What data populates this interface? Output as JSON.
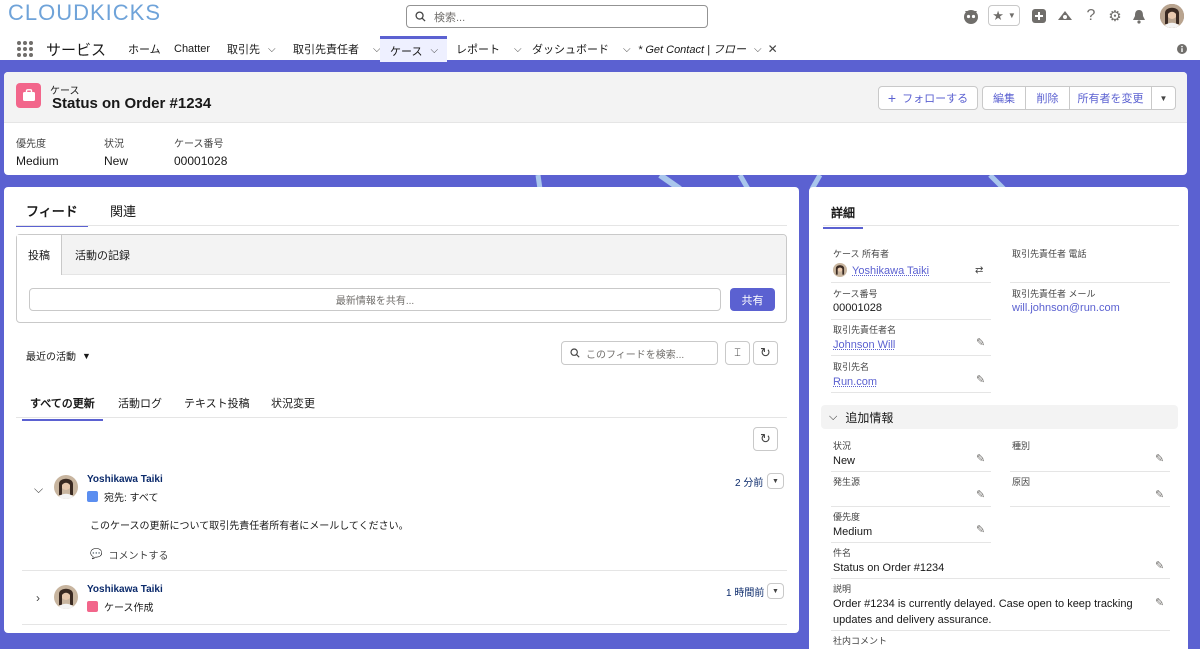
{
  "brand": {
    "logo": "CLOUDKICKS"
  },
  "search": {
    "placeholder": "検索..."
  },
  "nav": {
    "app_name": "サービス",
    "items": [
      {
        "label": "ホーム"
      },
      {
        "label": "Chatter"
      },
      {
        "label": "取引先"
      },
      {
        "label": "取引先責任者"
      },
      {
        "label": "ケース"
      },
      {
        "label": "レポート"
      },
      {
        "label": "ダッシュボード"
      },
      {
        "label": "* Get Contact | フロー"
      }
    ]
  },
  "record": {
    "object": "ケース",
    "title": "Status on Order #1234",
    "actions": {
      "follow": "フォローする",
      "edit": "編集",
      "delete": "削除",
      "change_owner": "所有者を変更"
    },
    "highlights": [
      {
        "label": "優先度",
        "value": "Medium"
      },
      {
        "label": "状況",
        "value": "New"
      },
      {
        "label": "ケース番号",
        "value": "00001028"
      }
    ]
  },
  "feed": {
    "tabs": {
      "feed": "フィード",
      "related": "関連"
    },
    "publisher": {
      "tab_post": "投稿",
      "tab_log": "活動の記録",
      "placeholder": "最新情報を共有...",
      "share": "共有"
    },
    "sort_label": "最近の活動",
    "search_placeholder": "このフィードを検索...",
    "filters": [
      "すべての更新",
      "活動ログ",
      "テキスト投稿",
      "状況変更"
    ],
    "items": [
      {
        "author": "Yoshikawa Taiki",
        "sub": "宛先: すべて",
        "time": "2 分前",
        "body": "このケースの更新について取引先責任者所有者にメールしてください。",
        "comment": "コメントする"
      },
      {
        "author": "Yoshikawa Taiki",
        "sub": "ケース作成",
        "time": "1 時間前"
      }
    ]
  },
  "details": {
    "tab": "詳細",
    "owner_label": "ケース 所有者",
    "owner_value": "Yoshikawa Taiki",
    "phone_label": "取引先責任者 電話",
    "case_no_label": "ケース番号",
    "case_no_value": "00001028",
    "email_label": "取引先責任者 メール",
    "email_value": "will.johnson@run.com",
    "contact_label": "取引先責任者名",
    "contact_value": "Johnson Will",
    "account_label": "取引先名",
    "account_value": "Run.com",
    "section": "追加情報",
    "status_label": "状況",
    "status_value": "New",
    "type_label": "種別",
    "origin_label": "発生源",
    "reason_label": "原因",
    "priority_label": "優先度",
    "priority_value": "Medium",
    "subject_label": "件名",
    "subject_value": "Status on Order #1234",
    "desc_label": "説明",
    "desc_value_1": "Order #1234 is currently delayed. Case open to keep tracking",
    "desc_value_2": "updates and delivery assurance.",
    "internal_label": "社内コメント"
  },
  "colors": {
    "brand": "#5b61d1",
    "case_icon": "#f2668b"
  }
}
